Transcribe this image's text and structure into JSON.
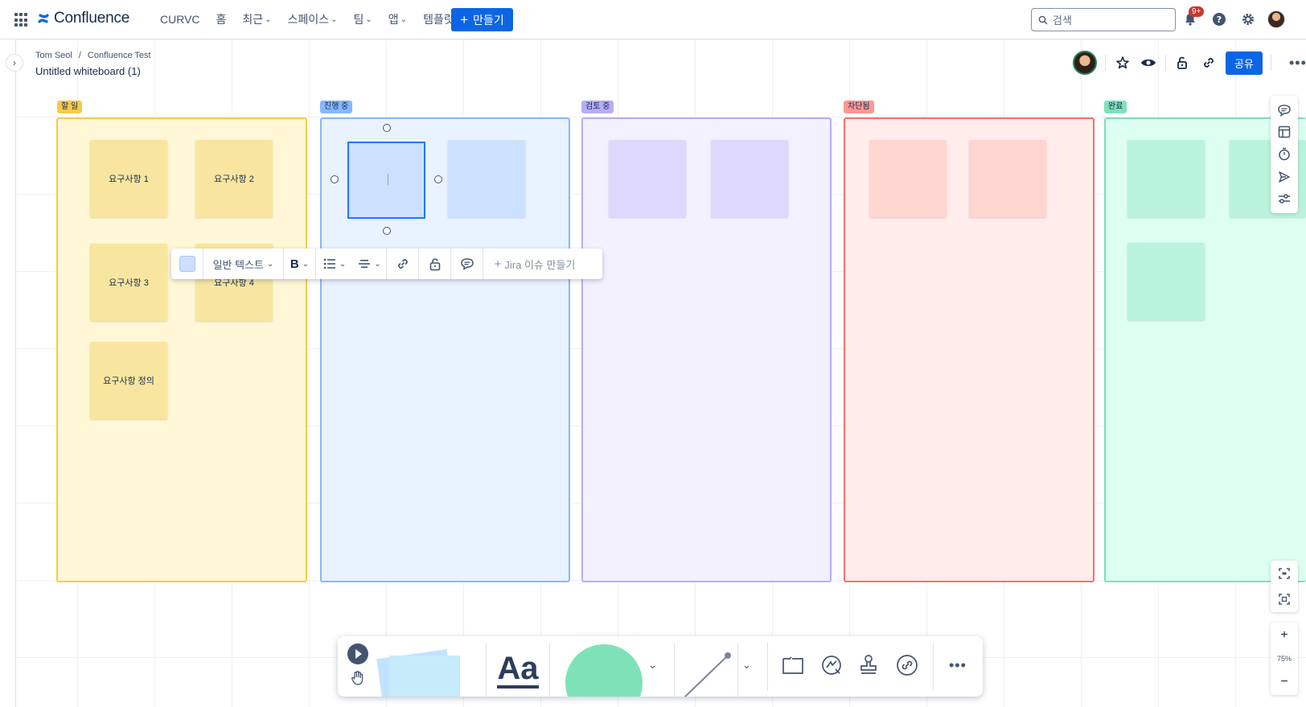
{
  "app": {
    "name": "Confluence",
    "nav": [
      {
        "label": "CURVC",
        "dropdown": false
      },
      {
        "label": "홈",
        "dropdown": false
      },
      {
        "label": "최근",
        "dropdown": true
      },
      {
        "label": "스페이스",
        "dropdown": true
      },
      {
        "label": "팀",
        "dropdown": true
      },
      {
        "label": "앱",
        "dropdown": true
      },
      {
        "label": "템플릿",
        "dropdown": false
      }
    ],
    "create_label": "만들기",
    "search_placeholder": "검색",
    "notification_badge": "9+"
  },
  "page": {
    "breadcrumb": [
      "Tom Seol",
      "Confluence Test"
    ],
    "title": "Untitled whiteboard (1)",
    "share_label": "공유"
  },
  "board": {
    "columns": [
      {
        "tag": "할 일",
        "tag_color": "#f8c94a",
        "border": "#f5cd47",
        "fill": "#fff7d6",
        "stickies": [
          "요구사항 1",
          "요구사항 2",
          "요구사항 3",
          "요구사항 4",
          "요구사항 정의"
        ],
        "sticky_color": "#f8e6a0"
      },
      {
        "tag": "진행 중",
        "tag_color": "#85b8ff",
        "border": "#85b8ff",
        "fill": "#e9f2ff",
        "stickies": [
          "",
          ""
        ],
        "sticky_color": "#cce0ff"
      },
      {
        "tag": "검토 중",
        "tag_color": "#b8acf6",
        "border": "#b8acf6",
        "fill": "#f3f0ff",
        "stickies": [
          "",
          ""
        ],
        "sticky_color": "#dfd8fd"
      },
      {
        "tag": "차단됨",
        "tag_color": "#fd9891",
        "border": "#f87168",
        "fill": "#ffeceb",
        "stickies": [
          "",
          ""
        ],
        "sticky_color": "#ffd5d2"
      },
      {
        "tag": "완료",
        "tag_color": "#7ee2b8",
        "border": "#7ee2b8",
        "fill": "#dcfff1",
        "stickies": [
          "",
          "",
          ""
        ],
        "sticky_color": "#baf3db"
      }
    ]
  },
  "text_toolbar": {
    "style_label": "일반 텍스트",
    "jira_label": "Jira 이슈 만들기",
    "swatch_color": "#cce0ff"
  },
  "zoom": {
    "level": "75%"
  },
  "bottom_toolbar": {
    "tools": [
      "select-tool",
      "hand-tool",
      "sticky-note-tool",
      "text-tool",
      "shape-tool",
      "line-tool",
      "frame-tool",
      "smart-tool",
      "stamp-tool",
      "link-tool",
      "more-tool"
    ],
    "text_tool_label": "Aa"
  }
}
